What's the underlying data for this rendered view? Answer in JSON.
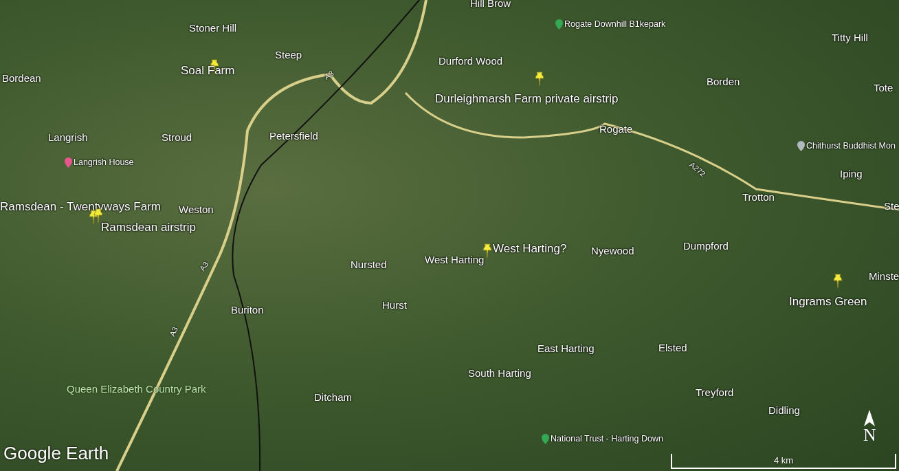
{
  "map": {
    "places": [
      {
        "name": "Hill Brow"
      },
      {
        "name": "Stoner Hill"
      },
      {
        "name": "Steep"
      },
      {
        "name": "Bordean"
      },
      {
        "name": "Durford Wood"
      },
      {
        "name": "Titty Hill"
      },
      {
        "name": "Borden"
      },
      {
        "name": "Tote"
      },
      {
        "name": "Langrish"
      },
      {
        "name": "Stroud"
      },
      {
        "name": "Petersfield"
      },
      {
        "name": "Rogate"
      },
      {
        "name": "Iping"
      },
      {
        "name": "Weston"
      },
      {
        "name": "Trotton"
      },
      {
        "name": "Ste"
      },
      {
        "name": "Nursted"
      },
      {
        "name": "West Harting"
      },
      {
        "name": "Nyewood"
      },
      {
        "name": "Dumpford"
      },
      {
        "name": "Minste"
      },
      {
        "name": "Hurst"
      },
      {
        "name": "Buriton"
      },
      {
        "name": "East Harting"
      },
      {
        "name": "Elsted"
      },
      {
        "name": "South Harting"
      },
      {
        "name": "Ditcham"
      },
      {
        "name": "Treyford"
      },
      {
        "name": "Didling"
      }
    ],
    "placemarks": [
      {
        "name": "Soal Farm"
      },
      {
        "name": "Durleighmarsh Farm private airstrip"
      },
      {
        "name": "Ramsdean - Twentyways Farm"
      },
      {
        "name": "Ramsdean airstrip"
      },
      {
        "name": "West Harting?"
      },
      {
        "name": "Ingrams Green"
      }
    ],
    "points_of_interest": [
      {
        "name": "Rogate Downhill B1kepark",
        "color": "#34a853"
      },
      {
        "name": "Langrish House",
        "color": "#e8578c"
      },
      {
        "name": "Chithurst Buddhist Mon",
        "color": "#b0b8c0"
      },
      {
        "name": "National Trust -  Harting Down",
        "color": "#34a853"
      }
    ],
    "park_label": "Queen Elizabeth Country Park",
    "road_labels": [
      "A3",
      "A272",
      "A3",
      "A3"
    ]
  },
  "logo": "Google Earth",
  "compass": "N",
  "scale_bar": {
    "label": "4 km"
  }
}
